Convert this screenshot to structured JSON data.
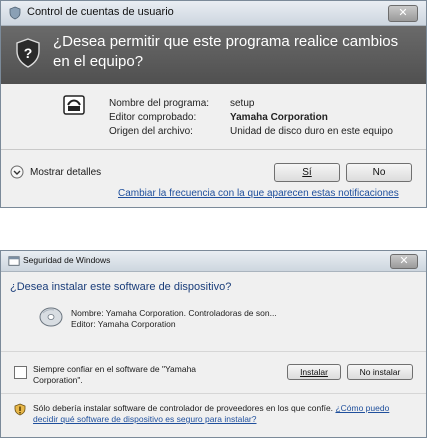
{
  "uac": {
    "title": "Control de cuentas de usuario",
    "question": "¿Desea permitir que este programa realice cambios en el equipo?",
    "program_label": "Nombre del programa:",
    "program_value": "setup",
    "publisher_label": "Editor comprobado:",
    "publisher_value": "Yamaha Corporation",
    "origin_label": "Origen del archivo:",
    "origin_value": "Unidad de disco duro en este equipo",
    "details_label": "Mostrar detalles",
    "yes_label": "Sí",
    "no_label": "No",
    "frequency_link": "Cambiar la frecuencia con la que aparecen estas notificaciones"
  },
  "security": {
    "title": "Seguridad de Windows",
    "question": "¿Desea instalar este software de dispositivo?",
    "name_line": "Nombre: Yamaha Corporation. Controladoras de son...",
    "publisher_line": "Editor: Yamaha Corporation",
    "always_trust": "Siempre confiar en el software de \"Yamaha Corporation\".",
    "install_label": "Instalar",
    "dont_install_label": "No instalar",
    "info_text": "Sólo debería instalar software de controlador de proveedores en los que confíe.",
    "info_link": "¿Cómo puedo decidir qué software de dispositivo es seguro para instalar?"
  }
}
